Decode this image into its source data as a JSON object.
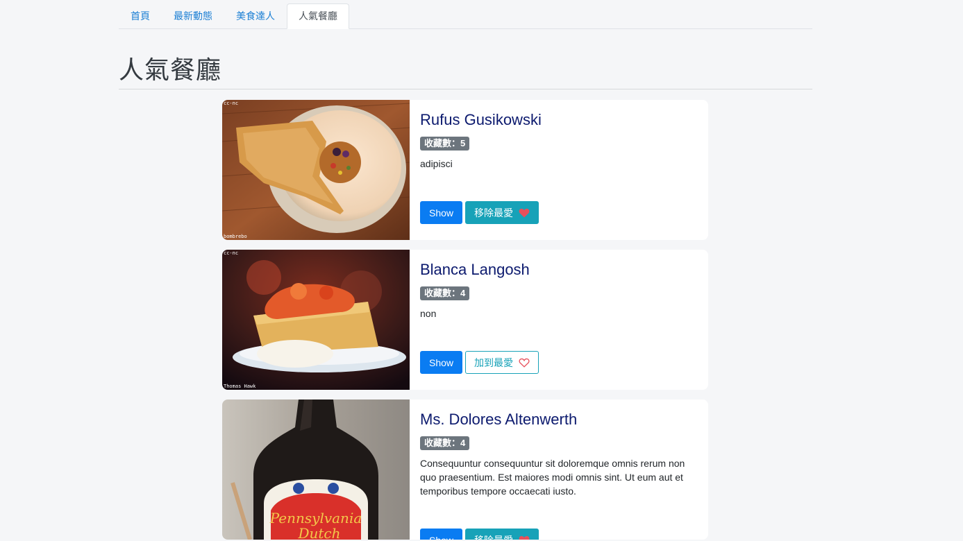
{
  "nav": {
    "tabs": [
      {
        "label": "首頁",
        "active": false
      },
      {
        "label": "最新動態",
        "active": false
      },
      {
        "label": "美食達人",
        "active": false
      },
      {
        "label": "人氣餐廳",
        "active": true
      }
    ]
  },
  "page": {
    "title": "人氣餐廳"
  },
  "restaurants": [
    {
      "name": "Rufus Gusikowski",
      "fav_count": "收藏數：5",
      "description": "adipisci",
      "show_label": "Show",
      "fav_label": "移除最愛",
      "favorited": true,
      "image_tags": [
        "cc-nc",
        "bombrebo"
      ]
    },
    {
      "name": "Blanca Langosh",
      "fav_count": "收藏數：4",
      "description": "non",
      "show_label": "Show",
      "fav_label": "加到最愛",
      "favorited": false,
      "image_tags": [
        "cc-nc",
        "Thomas Hawk"
      ]
    },
    {
      "name": "Ms. Dolores Altenwerth",
      "fav_count": "收藏數：4",
      "description": "Consequuntur consequuntur sit doloremque omnis rerum non quo praesentium. Est maiores modi omnis sint. Ut eum aut et temporibus tempore occaecati iusto.",
      "show_label": "Show",
      "fav_label": "移除最愛",
      "favorited": true,
      "image_tags": [
        "",
        ""
      ]
    }
  ],
  "colors": {
    "primary": "#0a7cf2",
    "info": "#17a2b8",
    "heart": "#e8505b",
    "title": "#0c1a6e"
  }
}
